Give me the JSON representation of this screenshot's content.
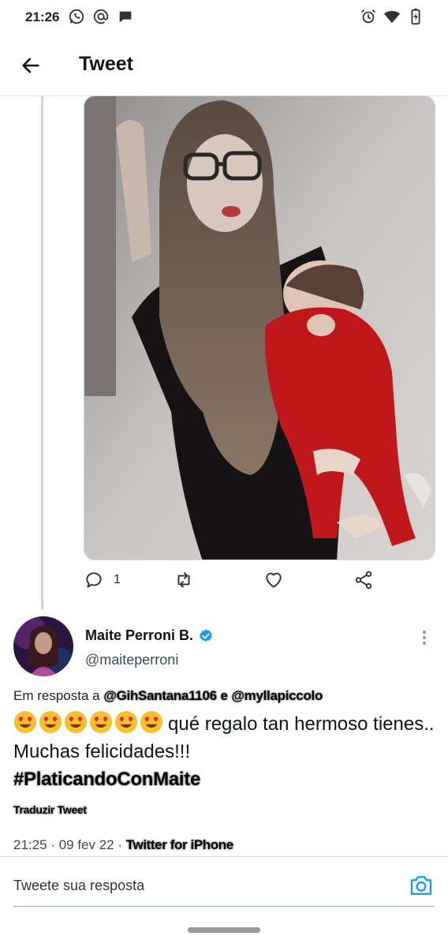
{
  "status_bar": {
    "time": "21:26",
    "left_icons": [
      "whatsapp-icon",
      "at-icon",
      "chat-bubble-icon"
    ],
    "right_icons": [
      "alarm-icon",
      "wifi-icon",
      "battery-charging-icon"
    ]
  },
  "header": {
    "title": "Tweet",
    "back_icon": "arrow-left-icon"
  },
  "parent_tweet": {
    "actions": [
      {
        "name": "reply",
        "icon": "reply-icon",
        "count": "1"
      },
      {
        "name": "retweet",
        "icon": "retweet-icon",
        "count": ""
      },
      {
        "name": "like",
        "icon": "heart-icon",
        "count": ""
      },
      {
        "name": "share",
        "icon": "share-icon",
        "count": ""
      }
    ]
  },
  "tweet": {
    "author_name": "Maite Perroni B.",
    "author_handle": "@maiteperroni",
    "verified": true,
    "reply_prefix": "Em resposta a",
    "reply_mention_1": "@GihSantana1106",
    "reply_conjunction": "e",
    "reply_mention_2": "@myllapiccolo",
    "emoji_count": 6,
    "emoji": "smiling-face-with-heart-eyes",
    "text_part1": "qué regalo tan hermoso tienes.. Muchas felicidades!!!",
    "hashtag": "#PlaticandoConMaite",
    "translate_label": "Traduzir Tweet",
    "time": "21:25",
    "date": "09 fev 22",
    "separator": "·",
    "source": "Twitter for iPhone"
  },
  "reply_bar": {
    "placeholder": "Tweete sua resposta",
    "camera_icon": "camera-icon"
  },
  "colors": {
    "accent": "#1d9bf0",
    "thread_line": "#c9d3dc",
    "text": "#0f1419"
  }
}
